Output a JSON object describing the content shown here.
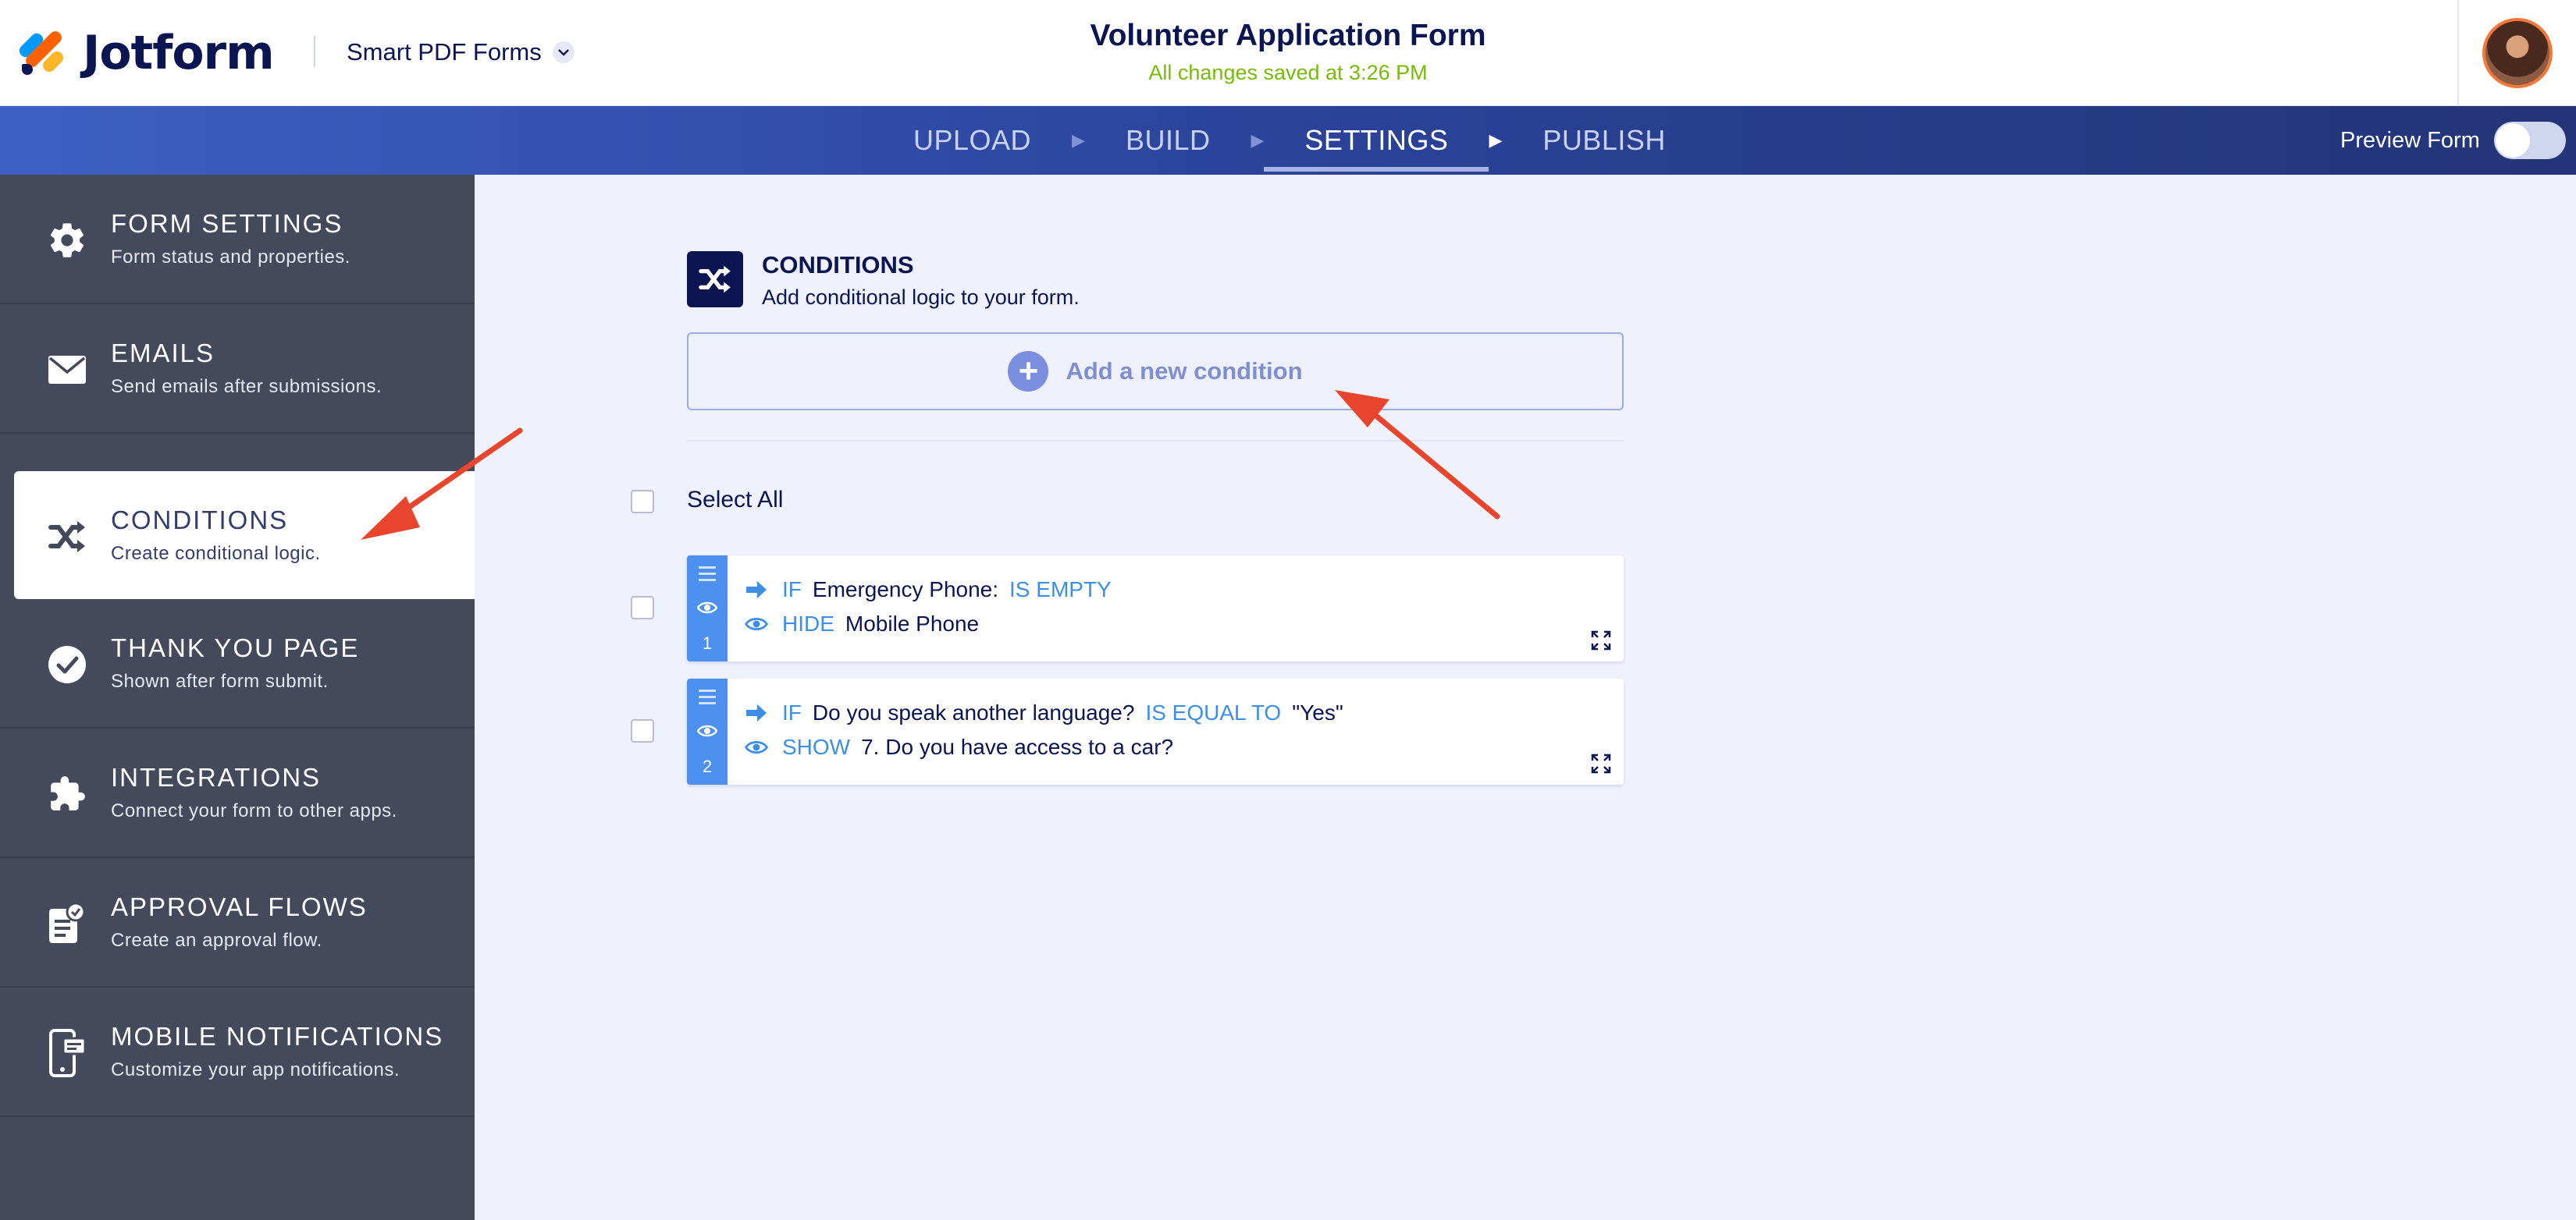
{
  "header": {
    "logo_text": "Jotform",
    "product_label": "Smart PDF Forms",
    "form_title": "Volunteer Application Form",
    "save_status": "All changes saved at 3:26 PM"
  },
  "nav": {
    "steps": [
      "UPLOAD",
      "BUILD",
      "SETTINGS",
      "PUBLISH"
    ],
    "active_step": "SETTINGS",
    "preview_label": "Preview Form",
    "preview_enabled": false
  },
  "sidebar": {
    "items": [
      {
        "title": "FORM SETTINGS",
        "subtitle": "Form status and properties.",
        "icon": "gear-icon"
      },
      {
        "title": "EMAILS",
        "subtitle": "Send emails after submissions.",
        "icon": "envelope-icon"
      },
      {
        "title": "CONDITIONS",
        "subtitle": "Create conditional logic.",
        "icon": "shuffle-icon"
      },
      {
        "title": "THANK YOU PAGE",
        "subtitle": "Shown after form submit.",
        "icon": "check-circle-icon"
      },
      {
        "title": "INTEGRATIONS",
        "subtitle": "Connect your form to other apps.",
        "icon": "puzzle-icon"
      },
      {
        "title": "APPROVAL FLOWS",
        "subtitle": "Create an approval flow.",
        "icon": "approval-icon"
      },
      {
        "title": "MOBILE NOTIFICATIONS",
        "subtitle": "Customize your app notifications.",
        "icon": "mobile-icon"
      }
    ],
    "active_item": "CONDITIONS"
  },
  "main": {
    "title": "CONDITIONS",
    "subtitle": "Add conditional logic to your form.",
    "add_button_label": "Add a new condition",
    "select_all_label": "Select All",
    "conditions": [
      {
        "number": "1",
        "if_keyword": "IF",
        "if_field": "Emergency Phone:",
        "operator": "IS EMPTY",
        "value": "",
        "action_keyword": "HIDE",
        "action_target": "Mobile Phone"
      },
      {
        "number": "2",
        "if_keyword": "IF",
        "if_field": "Do you speak another language?",
        "operator": "IS EQUAL TO",
        "value": "\"Yes\"",
        "action_keyword": "SHOW",
        "action_target": "7. Do you have access to a car?"
      }
    ]
  },
  "colors": {
    "brand_navy": "#0a1551",
    "nav_blue": "#2b4399",
    "sidebar_bg": "#44495b",
    "accent_blue": "#3d8fe6",
    "saved_green": "#78bb07",
    "annotation_red": "#e8452c"
  }
}
